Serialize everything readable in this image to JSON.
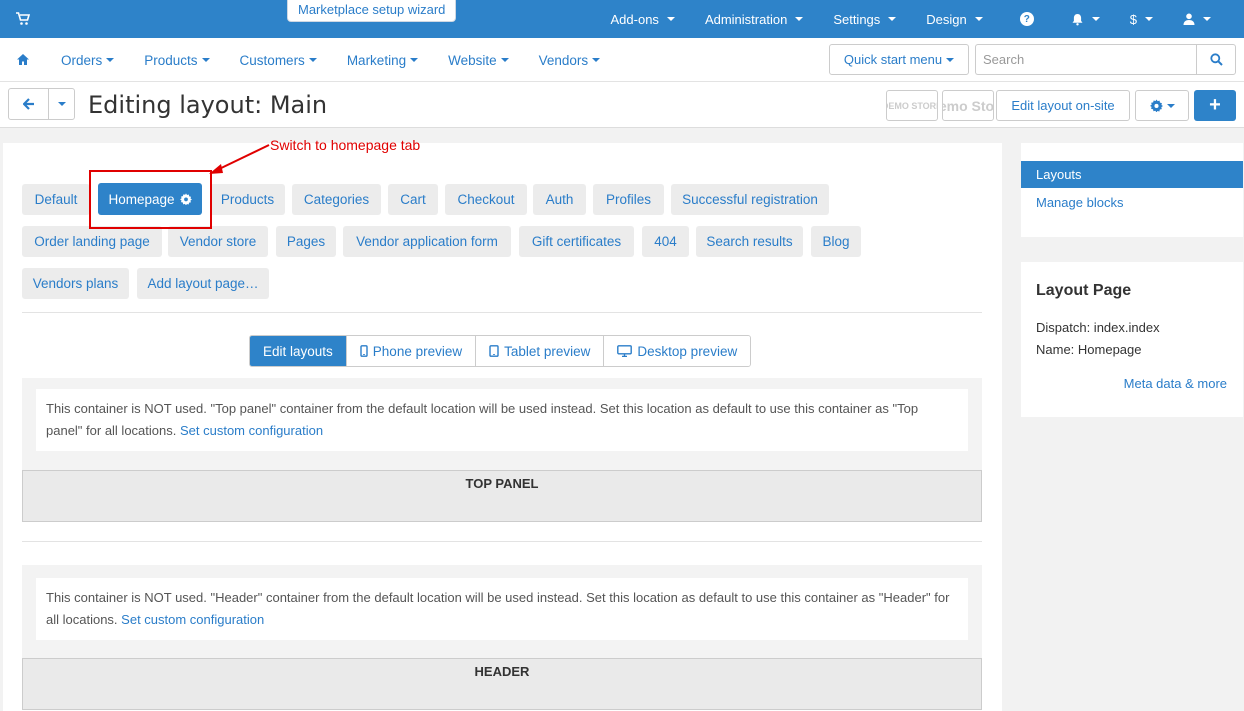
{
  "topbar": {
    "wizard": "Marketplace setup wizard",
    "items": [
      "Add-ons",
      "Administration",
      "Settings",
      "Design"
    ],
    "currency": "$",
    "accent_color": "#2e83c9"
  },
  "secnav": {
    "items": [
      "Orders",
      "Products",
      "Customers",
      "Marketing",
      "Website",
      "Vendors"
    ],
    "quick_start": "Quick start menu",
    "search_placeholder": "Search"
  },
  "page": {
    "title": "Editing layout: Main",
    "demo1": "DEMO STORE",
    "demo2": "Demo Store",
    "edit_on_site": "Edit layout on-site"
  },
  "tabs": {
    "row1": [
      "Default",
      "Homepage",
      "Products",
      "Categories",
      "Cart",
      "Checkout",
      "Auth",
      "Profiles",
      "Successful registration"
    ],
    "row2": [
      "Order landing page",
      "Vendor store",
      "Pages",
      "Vendor application form",
      "Gift certificates",
      "404",
      "Search results",
      "Blog"
    ],
    "row3": [
      "Vendors plans",
      "Add layout page…"
    ]
  },
  "preview_modes": [
    "Edit layouts",
    "Phone preview",
    "Tablet preview",
    "Desktop preview"
  ],
  "containers": [
    {
      "notice": "This container is NOT used. \"Top panel\" container from the default location will be used instead. Set this location as default to use this container as \"Top panel\" for all locations.",
      "link": "Set custom configuration",
      "label": "TOP PANEL"
    },
    {
      "notice": "This container is NOT used. \"Header\" container from the default location will be used instead. Set this location as default to use this container as \"Header\" for all locations.",
      "link": "Set custom configuration",
      "label": "HEADER"
    }
  ],
  "annotation": {
    "text": "Switch to homepage tab",
    "color": "#e00000"
  },
  "sidebar": {
    "menu": [
      "Layouts",
      "Manage blocks"
    ],
    "layout_page": {
      "title": "Layout Page",
      "dispatch": "Dispatch: index.index",
      "name": "Name: Homepage",
      "meta": "Meta data & more"
    }
  }
}
